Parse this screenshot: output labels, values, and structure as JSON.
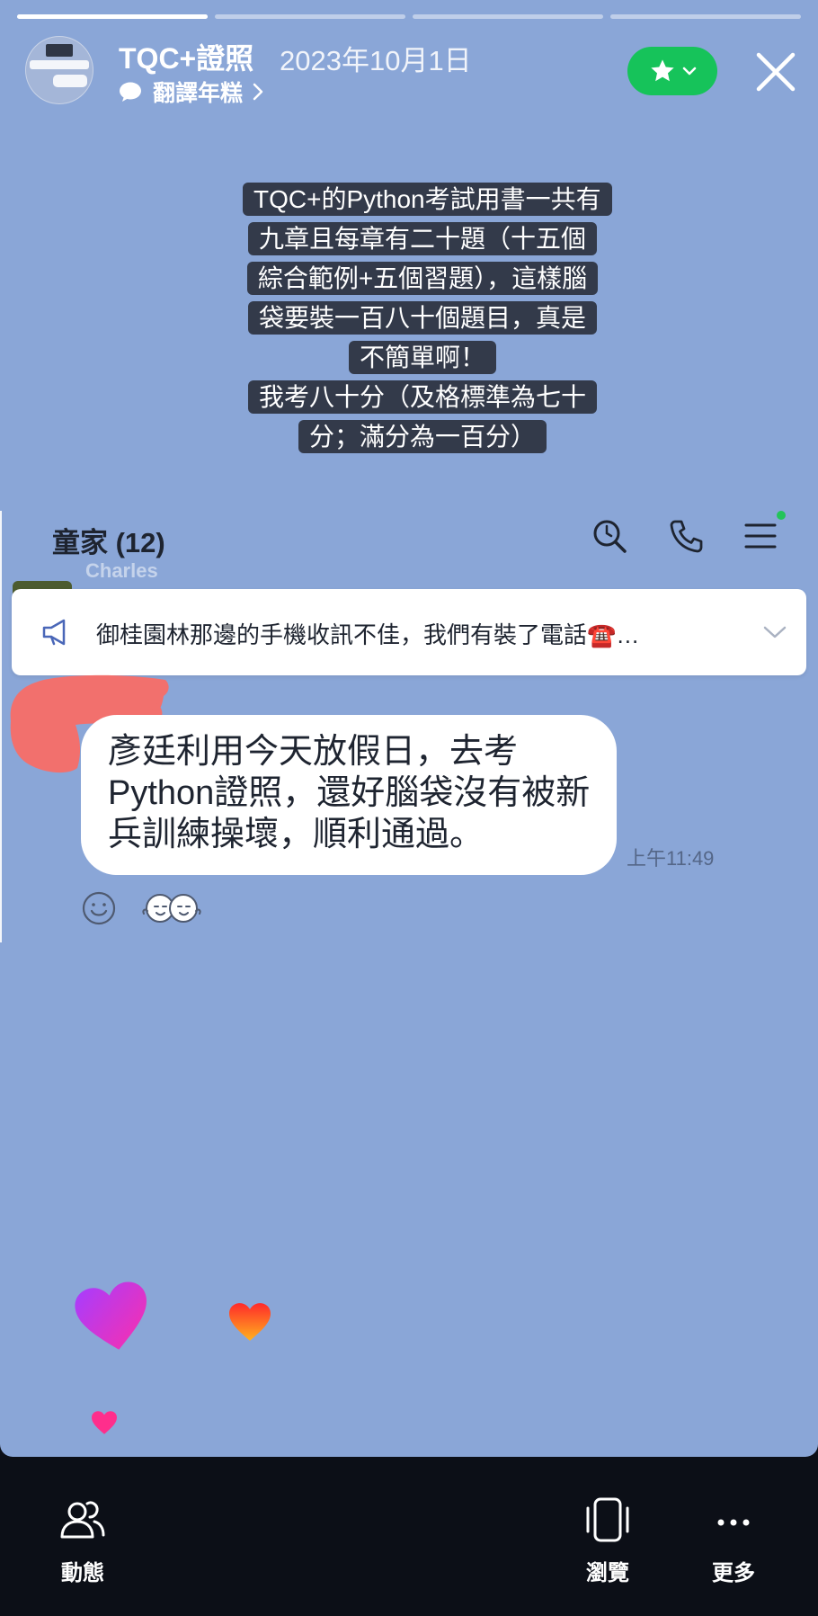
{
  "story": {
    "title": "TQC+證照",
    "date": "2023年10月1日",
    "subtitle": "翻譯年糕",
    "progress": [
      1.0,
      0,
      0,
      0
    ],
    "caption_lines": [
      "TQC+的Python考試用書一共有九章且每章有二十題（十五個綜合範例+五個習題），這樣腦袋要裝一百八十個題目，真是不簡單啊！",
      "我考八十分（及格標準為七十分；滿分為一百分）"
    ]
  },
  "chat": {
    "title": "童家 (12)",
    "faded_sender": "Charles",
    "announcement": "御桂園林那邊的手機收訊不佳，我們有裝了電話☎️…",
    "message": "彥廷利用今天放假日，去考Python證照，還好腦袋沒有被新兵訓練操壞，順利通過。",
    "time": "上午11:49"
  },
  "bottom_bar": {
    "activity_label": "動態",
    "browse_label": "瀏覽",
    "more_label": "更多"
  },
  "colors": {
    "story_bg": "#8aa6d7",
    "favorite_green": "#16c35a",
    "caption_bg": "#333a4a",
    "bottom_bg": "#0c0f17"
  },
  "icons": [
    "bubble-icon",
    "star-icon",
    "chevron-down-icon",
    "close-icon",
    "search-icon",
    "phone-icon",
    "menu-icon",
    "megaphone-icon",
    "smiley-icon",
    "heart-icon",
    "people-icon",
    "phone-frame-icon",
    "more-icon"
  ]
}
